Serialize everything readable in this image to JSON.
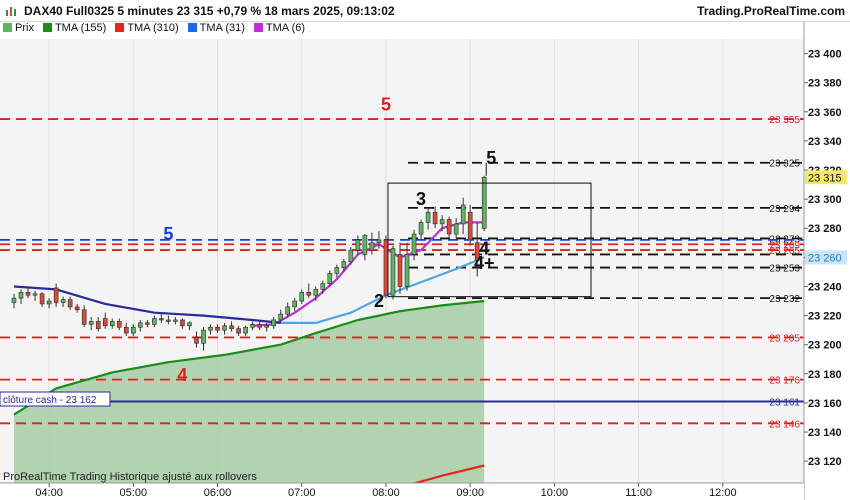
{
  "header": {
    "title": "DAX40 Full0325 5 minutes 23 315 +0,79 % 18 mars 2025, 09:13:02",
    "brand": "Trading.ProRealTime.com"
  },
  "legend": [
    {
      "label": "Prix",
      "color": "#5fb55f"
    },
    {
      "label": "TMA (155)",
      "color": "#1a8c1a"
    },
    {
      "label": "TMA (310)",
      "color": "#e8241c"
    },
    {
      "label": "TMA (31)",
      "color": "#1a6ae8"
    },
    {
      "label": "TMA (6)",
      "color": "#c030d8"
    }
  ],
  "footer": {
    "text": "ProRealTime Trading  Historique ajusté aux rollovers"
  },
  "colors": {
    "up": "#5fb55f",
    "down": "#d94a3a",
    "tma155": "#1a8c1a",
    "tma310": "#e8241c",
    "tma31": "#4da6e8",
    "tma6": "#c030d8",
    "navy": "#2a2aa0",
    "blue": "#1a3ae8",
    "red": "#e02020",
    "black": "#111111",
    "area": "#a6cca6",
    "bg": "#f4f4f4"
  },
  "chart_data": {
    "type": "candlestick",
    "instrument": "DAX40 Full0325",
    "timeframe": "5 minutes",
    "y_axis": {
      "min": 23105,
      "max": 23410,
      "ticks": [
        23120,
        23140,
        23160,
        23180,
        23200,
        23220,
        23240,
        23260,
        23280,
        23300,
        23320,
        23340,
        23360,
        23380,
        23400
      ],
      "tick_labels": [
        "23 120",
        "23 140",
        "23 160",
        "23 180",
        "23 200",
        "23 220",
        "23 240",
        "23 260",
        "23 280",
        "23 300",
        "23 320",
        "23 340",
        "23 360",
        "23 380",
        "23 400"
      ]
    },
    "x_axis": {
      "ticks": [
        "04:00",
        "05:00",
        "06:00",
        "07:00",
        "08:00",
        "09:00",
        "10:00",
        "11:00",
        "12:00"
      ],
      "times": [
        "03:35",
        "12:45"
      ]
    },
    "candles": [
      [
        "03:35",
        23229,
        23235,
        23225,
        23232
      ],
      [
        "03:40",
        23232,
        23238,
        23228,
        23236
      ],
      [
        "03:45",
        23236,
        23240,
        23232,
        23234
      ],
      [
        "03:50",
        23234,
        23237,
        23230,
        23235
      ],
      [
        "03:55",
        23235,
        23236,
        23226,
        23228
      ],
      [
        "04:00",
        23228,
        23232,
        23225,
        23230
      ],
      [
        "04:05",
        23239,
        23242,
        23226,
        23229
      ],
      [
        "04:10",
        23229,
        23233,
        23226,
        23231
      ],
      [
        "04:15",
        23231,
        23233,
        23224,
        23226
      ],
      [
        "04:20",
        23226,
        23228,
        23222,
        23224
      ],
      [
        "04:25",
        23224,
        23227,
        23212,
        23214
      ],
      [
        "04:30",
        23214,
        23219,
        23210,
        23216
      ],
      [
        "04:35",
        23216,
        23219,
        23209,
        23211
      ],
      [
        "04:40",
        23218,
        23222,
        23211,
        23213
      ],
      [
        "04:45",
        23213,
        23218,
        23211,
        23216
      ],
      [
        "04:50",
        23216,
        23218,
        23210,
        23212
      ],
      [
        "04:55",
        23212,
        23215,
        23206,
        23208
      ],
      [
        "05:00",
        23208,
        23214,
        23206,
        23212
      ],
      [
        "05:05",
        23212,
        23217,
        23209,
        23215
      ],
      [
        "05:10",
        23215,
        23217,
        23212,
        23214
      ],
      [
        "05:15",
        23214,
        23220,
        23212,
        23218
      ],
      [
        "05:20",
        23218,
        23221,
        23215,
        23217
      ],
      [
        "05:25",
        23217,
        23220,
        23214,
        23216
      ],
      [
        "05:30",
        23216,
        23219,
        23214,
        23217
      ],
      [
        "05:35",
        23217,
        23218,
        23211,
        23213
      ],
      [
        "05:40",
        23213,
        23216,
        23210,
        23215
      ],
      [
        "05:45",
        23205,
        23209,
        23198,
        23201
      ],
      [
        "05:50",
        23201,
        23212,
        23196,
        23210
      ],
      [
        "05:55",
        23210,
        23214,
        23207,
        23212
      ],
      [
        "06:00",
        23212,
        23214,
        23208,
        23210
      ],
      [
        "06:05",
        23210,
        23215,
        23207,
        23213
      ],
      [
        "06:10",
        23213,
        23216,
        23209,
        23211
      ],
      [
        "06:15",
        23211,
        23213,
        23206,
        23208
      ],
      [
        "06:20",
        23208,
        23213,
        23206,
        23212
      ],
      [
        "06:25",
        23212,
        23216,
        23210,
        23214
      ],
      [
        "06:30",
        23214,
        23216,
        23210,
        23212
      ],
      [
        "06:35",
        23212,
        23215,
        23209,
        23213
      ],
      [
        "06:40",
        23213,
        23219,
        23211,
        23217
      ],
      [
        "06:45",
        23217,
        23224,
        23215,
        23221
      ],
      [
        "06:50",
        23221,
        23229,
        23219,
        23226
      ],
      [
        "06:55",
        23226,
        23232,
        23223,
        23230
      ],
      [
        "07:00",
        23230,
        23238,
        23228,
        23236
      ],
      [
        "07:05",
        23236,
        23242,
        23232,
        23234
      ],
      [
        "07:10",
        23234,
        23240,
        23230,
        23238
      ],
      [
        "07:15",
        23238,
        23244,
        23235,
        23242
      ],
      [
        "07:20",
        23242,
        23251,
        23240,
        23249
      ],
      [
        "07:25",
        23249,
        23255,
        23246,
        23253
      ],
      [
        "07:30",
        23253,
        23259,
        23250,
        23257
      ],
      [
        "07:35",
        23257,
        23267,
        23255,
        23265
      ],
      [
        "07:40",
        23265,
        23275,
        23262,
        23272
      ],
      [
        "07:45",
        23262,
        23276,
        23258,
        23275
      ],
      [
        "07:50",
        23265,
        23277,
        23262,
        23270
      ],
      [
        "07:55",
        23270,
        23278,
        23266,
        23272
      ],
      [
        "08:00",
        23272,
        23275,
        23232,
        23234
      ],
      [
        "08:05",
        23234,
        23268,
        23231,
        23266
      ],
      [
        "08:10",
        23262,
        23270,
        23235,
        23240
      ],
      [
        "08:15",
        23240,
        23270,
        23237,
        23262
      ],
      [
        "08:20",
        23262,
        23279,
        23258,
        23276
      ],
      [
        "08:25",
        23276,
        23286,
        23272,
        23284
      ],
      [
        "08:30",
        23284,
        23294,
        23279,
        23291
      ],
      [
        "08:35",
        23291,
        23295,
        23280,
        23283
      ],
      [
        "08:40",
        23283,
        23289,
        23278,
        23286
      ],
      [
        "08:45",
        23286,
        23288,
        23272,
        23276
      ],
      [
        "08:50",
        23276,
        23287,
        23273,
        23283
      ],
      [
        "08:55",
        23283,
        23301,
        23276,
        23296
      ],
      [
        "09:00",
        23291,
        23296,
        23268,
        23272
      ],
      [
        "09:05",
        23270,
        23284,
        23247,
        23258
      ],
      [
        "09:10",
        23280,
        23316,
        23278,
        23315
      ]
    ],
    "series": [
      {
        "name": "TMA (6)",
        "points": [
          [
            "06:25",
            23213
          ],
          [
            "06:40",
            23214
          ],
          [
            "06:55",
            23222
          ],
          [
            "07:10",
            23232
          ],
          [
            "07:25",
            23245
          ],
          [
            "07:40",
            23262
          ],
          [
            "07:55",
            23269
          ],
          [
            "08:10",
            23260
          ],
          [
            "08:25",
            23265
          ],
          [
            "08:40",
            23280
          ],
          [
            "08:55",
            23284
          ],
          [
            "09:10",
            23284
          ]
        ]
      },
      {
        "name": "TMA (31)",
        "points": [
          [
            "06:45",
            23215
          ],
          [
            "07:10",
            23215
          ],
          [
            "07:35",
            23222
          ],
          [
            "08:00",
            23234
          ],
          [
            "08:25",
            23243
          ],
          [
            "08:50",
            23252
          ],
          [
            "09:10",
            23260
          ]
        ]
      },
      {
        "name": "TMA (31) earlier",
        "points": [
          [
            "03:35",
            23240
          ],
          [
            "04:05",
            23238
          ],
          [
            "04:40",
            23228
          ],
          [
            "05:15",
            23222
          ],
          [
            "05:50",
            23220
          ],
          [
            "06:25",
            23217
          ],
          [
            "06:45",
            23215
          ]
        ]
      },
      {
        "name": "TMA (155)",
        "points": [
          [
            "03:35",
            23152
          ],
          [
            "04:05",
            23170
          ],
          [
            "04:45",
            23181
          ],
          [
            "05:25",
            23188
          ],
          [
            "06:05",
            23193
          ],
          [
            "06:45",
            23200
          ],
          [
            "07:10",
            23208
          ],
          [
            "07:40",
            23217
          ],
          [
            "08:10",
            23223
          ],
          [
            "08:40",
            23227
          ],
          [
            "09:10",
            23230
          ]
        ]
      },
      {
        "name": "TMA (310)",
        "points": [
          [
            "07:40",
            23095
          ],
          [
            "08:10",
            23102
          ],
          [
            "08:40",
            23110
          ],
          [
            "09:10",
            23117
          ]
        ]
      }
    ],
    "levels": [
      {
        "value": 23355,
        "label": "23 355",
        "color": "red"
      },
      {
        "value": 23325,
        "label": "23 325",
        "color": "black"
      },
      {
        "value": 23294,
        "label": "23 294",
        "color": "black"
      },
      {
        "value": 23273,
        "label": "23 273",
        "color": "black"
      },
      {
        "value": 23272,
        "label": "",
        "color": "blue"
      },
      {
        "value": 23269,
        "label": "23 269",
        "color": "red"
      },
      {
        "value": 23265,
        "label": "23 265",
        "color": "red"
      },
      {
        "value": 23262,
        "label": "",
        "color": "black"
      },
      {
        "value": 23253,
        "label": "23 253",
        "color": "black"
      },
      {
        "value": 23232,
        "label": "23 232",
        "color": "black"
      },
      {
        "value": 23205,
        "label": "23 205",
        "color": "red"
      },
      {
        "value": 23176,
        "label": "23 176",
        "color": "red"
      },
      {
        "value": 23161,
        "label": "23 161",
        "color": "navy"
      },
      {
        "value": 23146,
        "label": "23 146",
        "color": "red"
      }
    ],
    "price_badges": [
      {
        "value": 23315,
        "label": "23 315",
        "bg": "#f5e96a",
        "fg": "#111111"
      },
      {
        "value": 23260,
        "label": "23 260",
        "bg": "#c8e4f5",
        "fg": "#2a7ac0"
      }
    ],
    "cash_close": {
      "value": 23162,
      "label": "clôture cash -  23 162"
    },
    "annotations": [
      {
        "text": "5",
        "time": "08:00",
        "price": 23361,
        "color": "red"
      },
      {
        "text": "5",
        "time": "05:25",
        "price": 23272,
        "color": "blue"
      },
      {
        "text": "4",
        "time": "05:35",
        "price": 23175,
        "color": "red"
      },
      {
        "text": "5",
        "time": "09:15",
        "price": 23324,
        "color": "black"
      },
      {
        "text": "3",
        "time": "08:25",
        "price": 23296,
        "color": "black"
      },
      {
        "text": "4",
        "time": "09:10",
        "price": 23262,
        "color": "black"
      },
      {
        "text": "4+",
        "time": "09:10",
        "price": 23252,
        "color": "black"
      },
      {
        "text": "2",
        "time": "07:55",
        "price": 23226,
        "color": "black"
      }
    ]
  }
}
